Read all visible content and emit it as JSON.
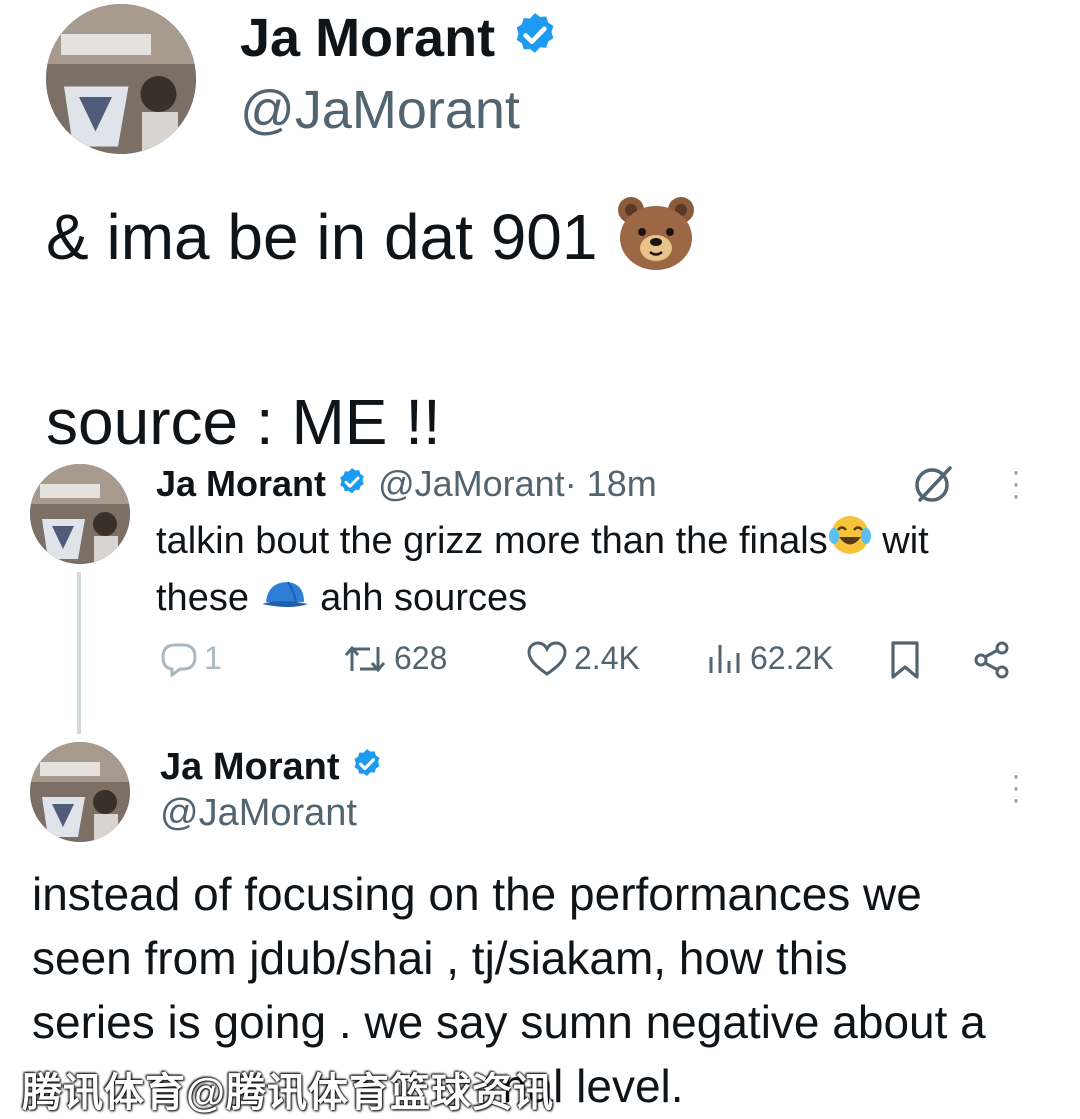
{
  "tweet_main": {
    "name": "Ja Morant",
    "handle": "@JaMorant",
    "text_line1": "& ima be in dat 901",
    "text_line1_emoji": "bear-face-emoji",
    "text_line2": "source : ME !!"
  },
  "tweet_quoted": {
    "name": "Ja Morant",
    "handle": "@JaMorant",
    "time": "· 18m",
    "text_part1": "talkin bout the grizz more than the finals",
    "text_emoji1": "face-with-tears-of-joy-emoji",
    "text_part2": " wit",
    "text_part3": "these ",
    "text_emoji2": "blue-cap-emoji",
    "text_part4": " ahh sources",
    "stats": {
      "replies": "1",
      "retweets": "628",
      "likes": "2.4K",
      "views": "62.2K"
    }
  },
  "tweet_reply": {
    "name": "Ja Morant",
    "handle": "@JaMorant",
    "lines": [
      "instead of focusing on the performances we",
      "seen from jdub/shai , tj/siakam, how this",
      "series is going . we say sumn negative about a"
    ],
    "last_line_visible": "nal level."
  },
  "watermark": {
    "text": "腾讯体育@腾讯体育篮球资讯"
  },
  "colors": {
    "text": "#0f1419",
    "secondary": "#536471",
    "verified_blue": "#1d9bf0",
    "thread_line": "#cfd9de"
  }
}
